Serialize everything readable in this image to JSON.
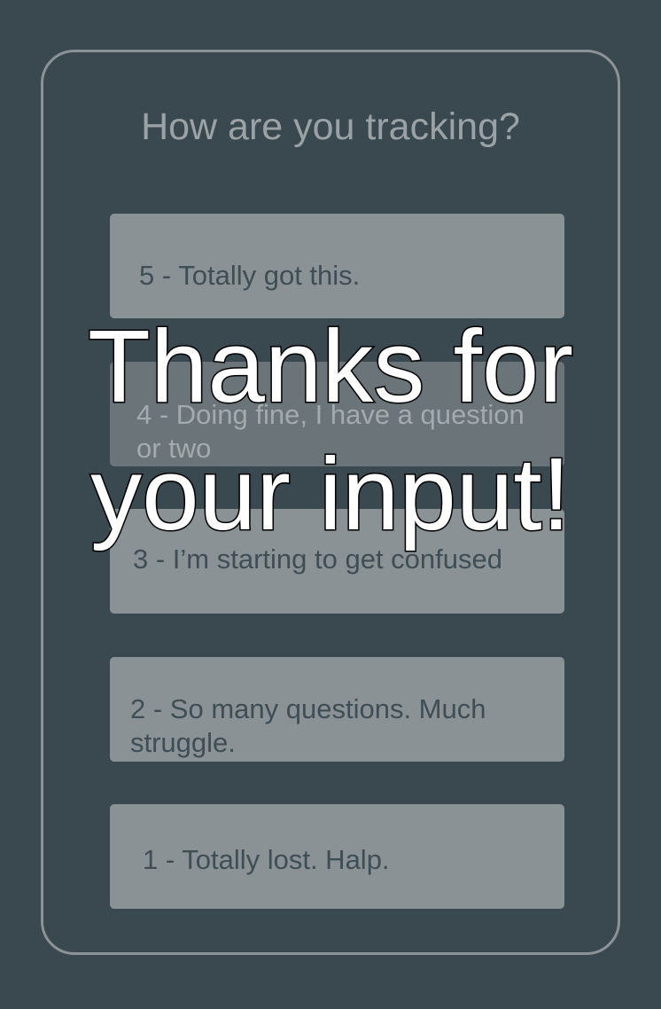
{
  "survey": {
    "title": "How are you tracking?",
    "options": [
      {
        "label": "5 - Totally got this.",
        "selected": false
      },
      {
        "label": "4 - Doing fine, I have a question or two",
        "selected": true
      },
      {
        "label": "3 - I’m starting to get confused",
        "selected": false
      },
      {
        "label": "2 - So many questions. Much struggle.",
        "selected": false
      },
      {
        "label": "1 - Totally lost. Halp.",
        "selected": false
      }
    ]
  },
  "overlay": {
    "message": "Thanks for your input!"
  },
  "colors": {
    "background": "#3a4850",
    "panel_border": "#8c9396",
    "option_bg": "#8a9296",
    "option_selected_bg": "#6b7478",
    "option_text": "#3f4d55",
    "overlay_text": "#ffffff"
  }
}
